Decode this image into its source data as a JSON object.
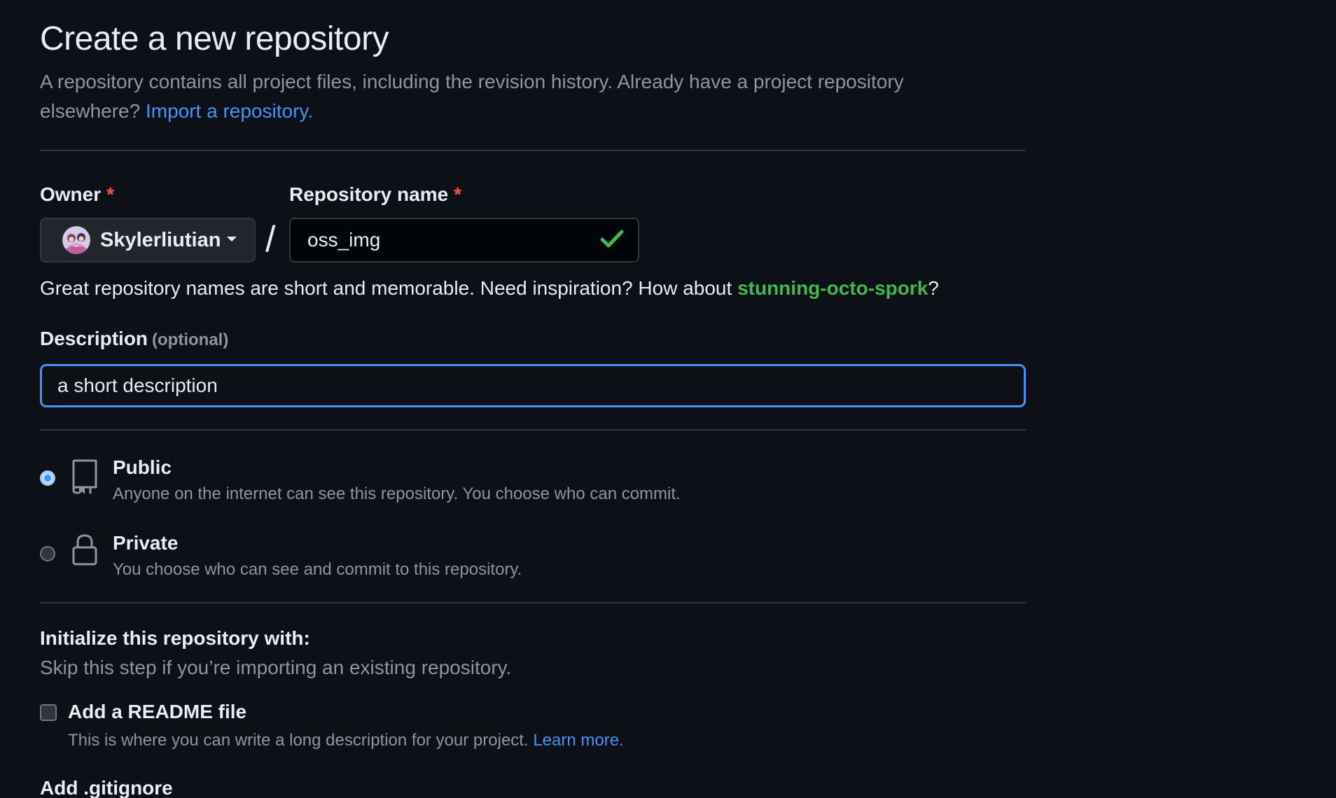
{
  "header": {
    "title": "Create a new repository",
    "subtitle": "A repository contains all project files, including the revision history. Already have a project repository elsewhere?",
    "import_link": "Import a repository."
  },
  "owner": {
    "label": "Owner",
    "required": "*",
    "value": "Skylerliutian"
  },
  "repo_name": {
    "label": "Repository name",
    "required": "*",
    "value": "oss_img",
    "valid_icon": "check-icon"
  },
  "separator": "/",
  "hint": {
    "text": "Great repository names are short and memorable. Need inspiration? How about",
    "suggestion": "stunning-octo-spork",
    "suffix": "?"
  },
  "description": {
    "label": "Description",
    "optional": "(optional)",
    "value": "a short description"
  },
  "visibility": {
    "selected": "public",
    "public": {
      "title": "Public",
      "desc": "Anyone on the internet can see this repository. You choose who can commit.",
      "icon": "repo-icon"
    },
    "private": {
      "title": "Private",
      "desc": "You choose who can see and commit to this repository.",
      "icon": "lock-icon"
    }
  },
  "init": {
    "title": "Initialize this repository with:",
    "subtitle": "Skip this step if you’re importing an existing repository.",
    "readme_label": "Add a README file",
    "readme_checked": false,
    "readme_desc": "This is where you can write a long description for your project.",
    "readme_link": "Learn more.",
    "gitignore_label": "Add .gitignore"
  },
  "colors": {
    "background": "#0d1117",
    "accent": "#4493f8",
    "success": "#3fb950",
    "danger": "#f85149"
  }
}
